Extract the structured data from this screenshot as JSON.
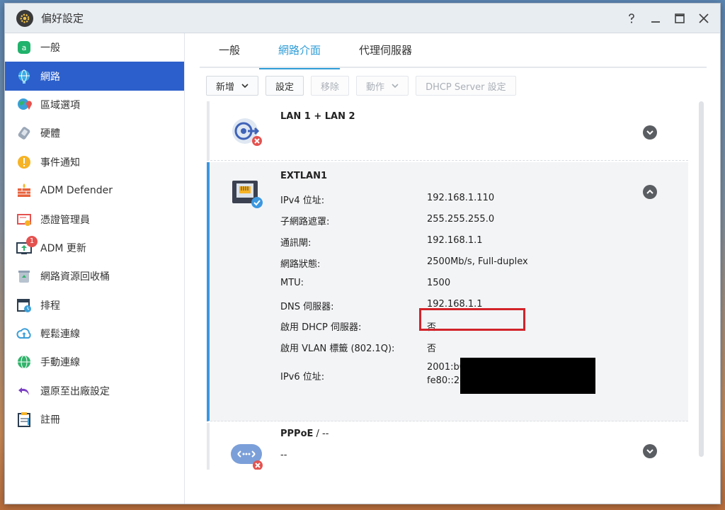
{
  "window": {
    "title": "偏好設定"
  },
  "sidebar": {
    "items": [
      {
        "label": "一般"
      },
      {
        "label": "網路"
      },
      {
        "label": "區域選項"
      },
      {
        "label": "硬體"
      },
      {
        "label": "事件通知"
      },
      {
        "label": "ADM Defender"
      },
      {
        "label": "憑證管理員"
      },
      {
        "label": "ADM 更新",
        "badge": "1"
      },
      {
        "label": "網路資源回收桶"
      },
      {
        "label": "排程"
      },
      {
        "label": "輕鬆連線"
      },
      {
        "label": "手動連線"
      },
      {
        "label": "還原至出廠設定"
      },
      {
        "label": "註冊"
      }
    ]
  },
  "tabs": [
    {
      "label": "一般"
    },
    {
      "label": "網路介面"
    },
    {
      "label": "代理伺服器"
    }
  ],
  "toolbar": {
    "add": "新增",
    "settings": "設定",
    "remove": "移除",
    "action": "動作",
    "dhcp": "DHCP Server 設定"
  },
  "interfaces": {
    "lan": {
      "title": "LAN 1 + LAN 2"
    },
    "extlan": {
      "title": "EXTLAN1",
      "rows": [
        {
          "key": "IPv4 位址:",
          "value": "192.168.1.110"
        },
        {
          "key": "子網路遮罩:",
          "value": "255.255.255.0"
        },
        {
          "key": "通訊閘:",
          "value": "192.168.1.1"
        },
        {
          "key": "網路狀態:",
          "value": "2500Mb/s, Full-duplex"
        },
        {
          "key": "MTU:",
          "value": "1500"
        },
        {
          "key": "DNS 伺服器:",
          "value": "192.168.1.1"
        },
        {
          "key": "啟用 DHCP 伺服器:",
          "value": "否"
        },
        {
          "key": "啟用 VLAN 標籤 (802.1Q):",
          "value": "否"
        },
        {
          "key": "IPv6 位址:",
          "value": ""
        }
      ],
      "ipv6": [
        "2001:b0",
        "fe80::2e"
      ]
    },
    "pppoe": {
      "title": "PPPoE",
      "title_suffix": " / --",
      "status": "--"
    }
  },
  "colors": {
    "accent": "#2f9dd7",
    "sidebar_active": "#2c5fcb",
    "highlight_box": "#d2232a"
  }
}
